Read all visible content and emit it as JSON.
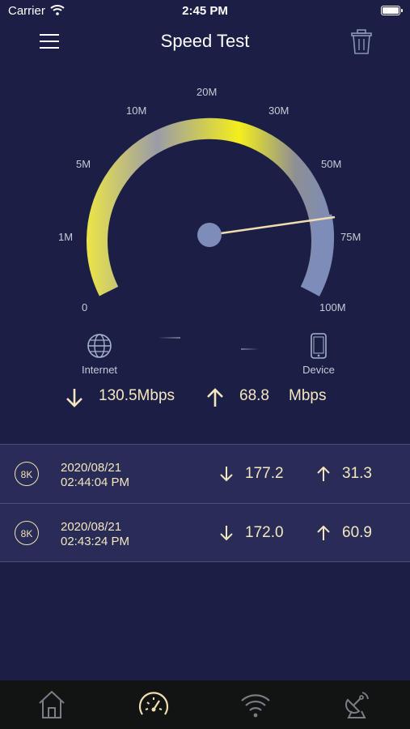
{
  "status_bar": {
    "carrier": "Carrier",
    "time": "2:45 PM"
  },
  "header": {
    "title": "Speed Test"
  },
  "gauge": {
    "ticks": [
      "0",
      "1M",
      "5M",
      "10M",
      "20M",
      "30M",
      "50M",
      "75M",
      "100M"
    ],
    "needle_value_label": "75M",
    "colors": {
      "arc_start": "#e9e34a",
      "arc_mid": "#9a9aa8",
      "arc_peak": "#f4ee1a",
      "arc_end": "#7d8cb8",
      "needle": "#f2dcb0",
      "hub": "#7d8cb8"
    }
  },
  "endpoints": {
    "internet": {
      "label": "Internet",
      "icon": "globe-icon"
    },
    "device": {
      "label": "Device",
      "icon": "phone-icon"
    }
  },
  "summary": {
    "download": "130.5Mbps",
    "upload_value": "68.8",
    "upload_unit": "Mbps"
  },
  "history": [
    {
      "badge": "8K",
      "date": "2020/08/21",
      "time": "02:44:04 PM",
      "download": "177.2",
      "upload": "31.3"
    },
    {
      "badge": "8K",
      "date": "2020/08/21",
      "time": "02:43:24 PM",
      "download": "172.0",
      "upload": "60.9"
    }
  ],
  "tabs": [
    {
      "icon": "home-icon",
      "active": false
    },
    {
      "icon": "speedometer-icon",
      "active": true
    },
    {
      "icon": "wifi-icon",
      "active": false
    },
    {
      "icon": "satellite-icon",
      "active": false
    }
  ],
  "accent_color": "#f5e6c0",
  "background_color": "#1b1f45"
}
